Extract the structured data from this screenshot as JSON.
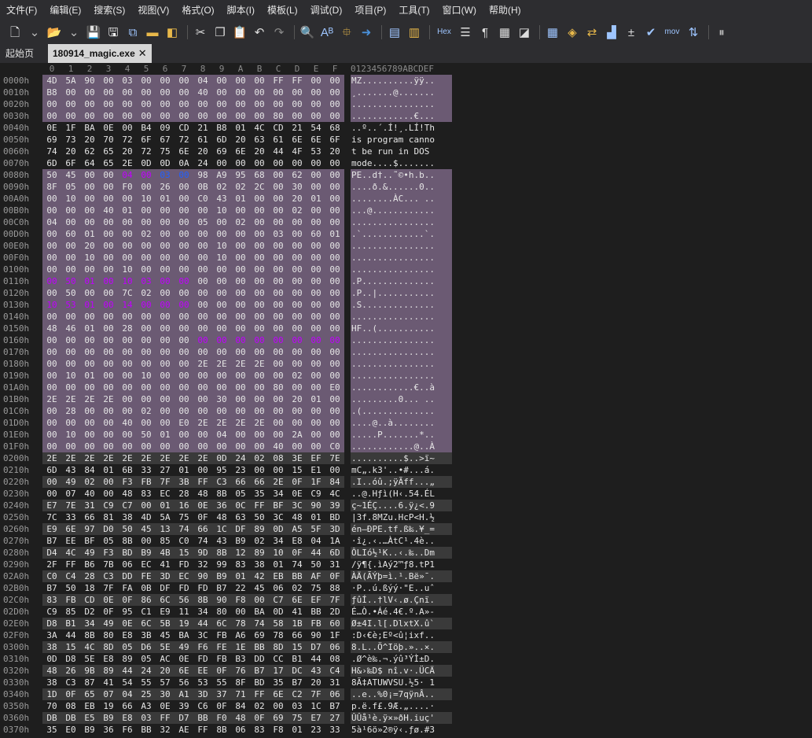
{
  "menu": [
    "文件(F)",
    "编辑(E)",
    "搜索(S)",
    "视图(V)",
    "格式(O)",
    "脚本(I)",
    "模板(L)",
    "调试(D)",
    "项目(P)",
    "工具(T)",
    "窗口(W)",
    "帮助(H)"
  ],
  "toolbar": [
    {
      "name": "new-file-icon",
      "glyph": "🗋",
      "color": "#ffffff"
    },
    {
      "name": "dropdown-arrow-icon",
      "glyph": "⌄",
      "color": "#bbbbbb"
    },
    {
      "name": "open-folder-icon",
      "glyph": "📂",
      "color": "#e8b84a"
    },
    {
      "name": "dropdown-arrow-icon",
      "glyph": "⌄",
      "color": "#bbbbbb"
    },
    {
      "name": "save-icon",
      "glyph": "💾",
      "color": "#4a90d9"
    },
    {
      "name": "save-as-icon",
      "glyph": "🖫",
      "color": "#ffffff"
    },
    {
      "name": "save-all-icon",
      "glyph": "⧉",
      "color": "#9ec5ff"
    },
    {
      "name": "folder-icon",
      "glyph": "▬",
      "color": "#e8b84a"
    },
    {
      "name": "open-project-icon",
      "glyph": "◧",
      "color": "#e8b84a"
    },
    {
      "name": "sep",
      "glyph": "",
      "color": ""
    },
    {
      "name": "cut-icon",
      "glyph": "✂",
      "color": "#dddddd"
    },
    {
      "name": "copy-icon",
      "glyph": "❐",
      "color": "#dddddd"
    },
    {
      "name": "paste-icon",
      "glyph": "📋",
      "color": "#dddddd"
    },
    {
      "name": "undo-icon",
      "glyph": "↶",
      "color": "#dddddd"
    },
    {
      "name": "redo-icon",
      "glyph": "↷",
      "color": "#888888"
    },
    {
      "name": "sep",
      "glyph": "",
      "color": ""
    },
    {
      "name": "find-icon",
      "glyph": "🔍",
      "color": "#dddddd"
    },
    {
      "name": "replace-icon",
      "glyph": "Aᴮ",
      "color": "#9ec5ff"
    },
    {
      "name": "find-in-files-icon",
      "glyph": "⯐",
      "color": "#e8b84a"
    },
    {
      "name": "goto-icon",
      "glyph": "➜",
      "color": "#4a90d9"
    },
    {
      "name": "sep",
      "glyph": "",
      "color": ""
    },
    {
      "name": "bookmark-icon",
      "glyph": "▤",
      "color": "#9ec5ff"
    },
    {
      "name": "bookmark-next-icon",
      "glyph": "▥",
      "color": "#e8b84a"
    },
    {
      "name": "sep",
      "glyph": "",
      "color": ""
    },
    {
      "name": "hex-mode-icon",
      "glyph": "Hex",
      "color": "#9ec5ff"
    },
    {
      "name": "text-mode-icon",
      "glyph": "☰",
      "color": "#dddddd"
    },
    {
      "name": "show-whitespace-icon",
      "glyph": "¶",
      "color": "#dddddd"
    },
    {
      "name": "columns-icon",
      "glyph": "▦",
      "color": "#dddddd"
    },
    {
      "name": "highlight-icon",
      "glyph": "◪",
      "color": "#dddddd"
    },
    {
      "name": "sep",
      "glyph": "",
      "color": ""
    },
    {
      "name": "calculator-icon",
      "glyph": "▦",
      "color": "#9ec5ff"
    },
    {
      "name": "templates-icon",
      "glyph": "◈",
      "color": "#e8b84a"
    },
    {
      "name": "compare-icon",
      "glyph": "⇄",
      "color": "#e8b84a"
    },
    {
      "name": "histogram-icon",
      "glyph": "▟",
      "color": "#9ec5ff"
    },
    {
      "name": "checksum-icon",
      "glyph": "±",
      "color": "#dddddd"
    },
    {
      "name": "check-icon",
      "glyph": "✔",
      "color": "#9ec5ff"
    },
    {
      "name": "disassembler-icon",
      "glyph": "mov",
      "color": "#9ec5ff"
    },
    {
      "name": "convert-icon",
      "glyph": "⇅",
      "color": "#9ec5ff"
    },
    {
      "name": "sep",
      "glyph": "",
      "color": ""
    },
    {
      "name": "pause-icon",
      "glyph": "⏸",
      "color": "#bbbbbb"
    }
  ],
  "tabs": {
    "home": "起始页",
    "active": "180914_magic.exe",
    "close_glyph": "✕"
  },
  "hex": {
    "column_labels": [
      "0",
      "1",
      "2",
      "3",
      "4",
      "5",
      "6",
      "7",
      "8",
      "9",
      "A",
      "B",
      "C",
      "D",
      "E",
      "F"
    ],
    "ascii_header": "0123456789ABCDEF",
    "rows": [
      {
        "off": "0000h",
        "hex": "4D 5A 90 00 03 00 00 00 04 00 00 00 FF FF 00 00",
        "ascii": "MZ..........ÿÿ..",
        "bg": "full"
      },
      {
        "off": "0010h",
        "hex": "B8 00 00 00 00 00 00 00 40 00 00 00 00 00 00 00",
        "ascii": "¸.......@.......",
        "bg": "full"
      },
      {
        "off": "0020h",
        "hex": "00 00 00 00 00 00 00 00 00 00 00 00 00 00 00 00",
        "ascii": "................",
        "bg": "full"
      },
      {
        "off": "0030h",
        "hex": "00 00 00 00 00 00 00 00 00 00 00 00 80 00 00 00",
        "ascii": "............€...",
        "bg": "full"
      },
      {
        "off": "0040h",
        "hex": "0E 1F BA 0E 00 B4 09 CD 21 B8 01 4C CD 21 54 68",
        "ascii": "..º..´.Í!¸.LÍ!Th",
        "bg": "none"
      },
      {
        "off": "0050h",
        "hex": "69 73 20 70 72 6F 67 72 61 6D 20 63 61 6E 6E 6F",
        "ascii": "is program canno",
        "bg": "none"
      },
      {
        "off": "0060h",
        "hex": "74 20 62 65 20 72 75 6E 20 69 6E 20 44 4F 53 20",
        "ascii": "t be run in DOS ",
        "bg": "none"
      },
      {
        "off": "0070h",
        "hex": "6D 6F 64 65 2E 0D 0D 0A 24 00 00 00 00 00 00 00",
        "ascii": "mode....$.......",
        "bg": "none"
      },
      {
        "off": "0080h",
        "hex": "50 45 00 00 04 00 03 00 98 A9 95 68 00 62 00 00",
        "ascii": "PE..d†..˜©•h.b..",
        "bg": "full",
        "hl": [
          4,
          5
        ],
        "hb": [
          6,
          7
        ]
      },
      {
        "off": "0090h",
        "hex": "8F 05 00 00 F0 00 26 00 0B 02 02 2C 00 30 00 00",
        "ascii": "....ð.&......0..",
        "bg": "full"
      },
      {
        "off": "00A0h",
        "hex": "00 10 00 00 00 10 01 00 C0 43 01 00 00 20 01 00",
        "ascii": "........ÀC... ..",
        "bg": "full"
      },
      {
        "off": "00B0h",
        "hex": "00 00 00 40 01 00 00 00 00 10 00 00 00 02 00 00",
        "ascii": "...@............",
        "bg": "full"
      },
      {
        "off": "00C0h",
        "hex": "04 00 00 00 00 00 00 00 05 00 02 00 00 00 00 00",
        "ascii": "................",
        "bg": "full"
      },
      {
        "off": "00D0h",
        "hex": "00 60 01 00 00 02 00 00 00 00 00 00 03 00 60 01",
        "ascii": ".`............`.",
        "bg": "full"
      },
      {
        "off": "00E0h",
        "hex": "00 00 20 00 00 00 00 00 00 10 00 00 00 00 00 00",
        "ascii": "................",
        "bg": "full"
      },
      {
        "off": "00F0h",
        "hex": "00 00 10 00 00 00 00 00 00 10 00 00 00 00 00 00",
        "ascii": "................",
        "bg": "full"
      },
      {
        "off": "0100h",
        "hex": "00 00 00 00 10 00 00 00 00 00 00 00 00 00 00 00",
        "ascii": "................",
        "bg": "full"
      },
      {
        "off": "0110h",
        "hex": "00 50 01 00 10 03 00 00 00 00 00 00 00 00 00 00",
        "ascii": ".P..............",
        "bg": "full",
        "hl": [
          0,
          1,
          2,
          3,
          4,
          5,
          6,
          7
        ]
      },
      {
        "off": "0120h",
        "hex": "00 50 00 00 7C 02 00 00 00 00 00 00 00 00 00 00",
        "ascii": ".P..|...........",
        "bg": "full"
      },
      {
        "off": "0130h",
        "hex": "10 53 01 00 14 00 00 00 00 00 00 00 00 00 00 00",
        "ascii": ".S..............",
        "bg": "full",
        "hl": [
          0,
          1,
          2,
          3,
          4,
          5,
          6,
          7
        ]
      },
      {
        "off": "0140h",
        "hex": "00 00 00 00 00 00 00 00 00 00 00 00 00 00 00 00",
        "ascii": "................",
        "bg": "full"
      },
      {
        "off": "0150h",
        "hex": "48 46 01 00 28 00 00 00 00 00 00 00 00 00 00 00",
        "ascii": "HF..(...........",
        "bg": "full"
      },
      {
        "off": "0160h",
        "hex": "00 00 00 00 00 00 00 00 00 00 00 00 00 00 00 00",
        "ascii": "................",
        "bg": "full",
        "hl": [
          8,
          9,
          10,
          11,
          12,
          13,
          14,
          15
        ]
      },
      {
        "off": "0170h",
        "hex": "00 00 00 00 00 00 00 00 00 00 00 00 00 00 00 00",
        "ascii": "................",
        "bg": "full"
      },
      {
        "off": "0180h",
        "hex": "00 00 00 00 00 00 00 00 2E 2E 2E 2E 00 00 00 00",
        "ascii": "................",
        "bg": "full"
      },
      {
        "off": "0190h",
        "hex": "00 10 01 00 00 10 00 00 00 00 00 00 00 02 00 00",
        "ascii": "................",
        "bg": "full"
      },
      {
        "off": "01A0h",
        "hex": "00 00 00 00 00 00 00 00 00 00 00 00 80 00 00 E0",
        "ascii": "............€..à",
        "bg": "full"
      },
      {
        "off": "01B0h",
        "hex": "2E 2E 2E 2E 00 00 00 00 00 30 00 00 00 20 01 00",
        "ascii": ".........0... ..",
        "bg": "full"
      },
      {
        "off": "01C0h",
        "hex": "00 28 00 00 00 02 00 00 00 00 00 00 00 00 00 00",
        "ascii": ".(..............",
        "bg": "full"
      },
      {
        "off": "01D0h",
        "hex": "00 00 00 00 40 00 00 E0 2E 2E 2E 2E 00 00 00 00",
        "ascii": "....@..à........",
        "bg": "full"
      },
      {
        "off": "01E0h",
        "hex": "00 10 00 00 00 50 01 00 00 04 00 00 00 2A 00 00",
        "ascii": ".....P.......*..",
        "bg": "full"
      },
      {
        "off": "01F0h",
        "hex": "00 00 00 00 00 00 00 00 00 00 00 00 40 00 00 C0",
        "ascii": "............@..À",
        "bg": "full"
      },
      {
        "off": "0200h",
        "hex": "2E 2E 2E 2E 2E 2E 2E 2E 2E 0D 24 02 08 3E EF 7E",
        "ascii": "..........$..>ï~",
        "bg": "stripe"
      },
      {
        "off": "0210h",
        "hex": "6D 43 84 01 6B 33 27 01 00 95 23 00 00 15 E1 00",
        "ascii": "mC„.k3'..•#...á.",
        "bg": "stripe"
      },
      {
        "off": "0220h",
        "hex": "00 49 02 00 F3 FB 7F 3B FF C3 66 66 2E 0F 1F 84",
        "ascii": ".I..óû.;ÿÃff...„",
        "bg": "stripe"
      },
      {
        "off": "0230h",
        "hex": "00 07 40 00 48 83 EC 28 48 8B 05 35 34 0E C9 4C",
        "ascii": "..@.Hƒì(H‹.54.ÉL",
        "bg": "stripe"
      },
      {
        "off": "0240h",
        "hex": "E7 7E 31 C9 C7 00 01 16 0E 36 0C FF BF 3C 90 39",
        "ascii": "ç~1ÉÇ....6.ÿ¿<.9",
        "bg": "stripe"
      },
      {
        "off": "0250h",
        "hex": "7C 33 66 81 38 4D 5A 75 0F 48 63 50 3C 48 01 BD",
        "ascii": "|3f.8MZu.HcP<H.½",
        "bg": "stripe"
      },
      {
        "off": "0260h",
        "hex": "E9 6E 97 D0 50 45 13 74 66 1C DF 89 0D A5 5F 3D",
        "ascii": "én—ÐPE.tf.ß‰.¥_=",
        "bg": "stripe"
      },
      {
        "off": "0270h",
        "hex": "B7 EE BF 05 8B 00 85 C0 74 43 B9 02 34 E8 04 1A",
        "ascii": "·î¿.‹.…ÀtC¹.4è..",
        "bg": "stripe"
      },
      {
        "off": "0280h",
        "hex": "D4 4C 49 F3 BD B9 4B 15 9D 8B 12 89 10 0F 44 6D",
        "ascii": "ÔLIó½¹K..‹.‰..Dm",
        "bg": "stripe"
      },
      {
        "off": "0290h",
        "hex": "2F FF B6 7B 06 EC 41 FD 32 99 83 38 01 74 50 31",
        "ascii": "/ÿ¶{.ìAý2™ƒ8.tP1",
        "bg": "stripe"
      },
      {
        "off": "02A0h",
        "hex": "C0 C4 28 C3 DD FE 3D EC 90 B9 01 42 EB BB AF 0F",
        "ascii": "ÀÄ(ÃÝþ=ì.¹.Bë»¯.",
        "bg": "stripe"
      },
      {
        "off": "02B0h",
        "hex": "B7 50 18 7F FA 0B DF FD FD B7 22 45 06 02 75 88",
        "ascii": "·P..ú.ßýý·\"E..uˆ",
        "bg": "stripe"
      },
      {
        "off": "02C0h",
        "hex": "83 FB CD 0E 0F 86 6C 56 8B 90 F8 00 C7 6E EF 7F",
        "ascii": "ƒûÍ..†lV‹.ø.Çnï.",
        "bg": "stripe"
      },
      {
        "off": "02D0h",
        "hex": "C9 85 D2 0F 95 C1 E9 11 34 80 00 BA 0D 41 BB 2D",
        "ascii": "É…Ò.•Áé.4€.º.A»-",
        "bg": "stripe"
      },
      {
        "off": "02E0h",
        "hex": "D8 B1 34 49 0E 6C 5B 19 44 6C 78 74 58 1B FB 60",
        "ascii": "Ø±4I.l[.DlxtX.û`",
        "bg": "stripe"
      },
      {
        "off": "02F0h",
        "hex": "3A 44 8B 80 E8 3B 45 BA 3C FB A6 69 78 66 90 1F",
        "ascii": ":D‹€è;Eº<û¦ixf..",
        "bg": "stripe"
      },
      {
        "off": "0300h",
        "hex": "38 15 4C 8D 05 D6 5E 49 F6 FE 1E BB 8D 15 D7 06",
        "ascii": "8.L..Ö^Iöþ.»..×.",
        "bg": "stripe"
      },
      {
        "off": "0310h",
        "hex": "0D D8 5E E8 89 05 AC 0E FD FB B3 DD CC B1 44 08",
        "ascii": ".Ø^è‰.¬.ýû³ÝÌ±D.",
        "bg": "stripe"
      },
      {
        "off": "0320h",
        "hex": "48 26 9B 89 44 24 20 6E EE 0F 76 B7 17 DC 43 C4",
        "ascii": "H&›‰D$ nî.v·.ÜCÄ",
        "bg": "stripe"
      },
      {
        "off": "0330h",
        "hex": "38 C3 87 41 54 55 57 56 53 55 8F BD 35 B7 20 31",
        "ascii": "8Ã‡ATUWVSU.½5· 1",
        "bg": "stripe"
      },
      {
        "off": "0340h",
        "hex": "1D 0F 65 07 04 25 30 A1 3D 37 71 FF 6E C2 7F 06",
        "ascii": "..e..%0¡=7qÿnÂ..",
        "bg": "stripe"
      },
      {
        "off": "0350h",
        "hex": "70 08 EB 19 66 A3 0E 39 C6 0F 84 02 00 03 1C B7",
        "ascii": "p.ë.f£.9Æ.„....·",
        "bg": "stripe"
      },
      {
        "off": "0360h",
        "hex": "DB DB E5 B9 E8 03 FF D7 BB F0 48 0F 69 75 E7 27",
        "ascii": "ÛÛå¹è.ÿ×»ðH.iuç'",
        "bg": "stripe"
      },
      {
        "off": "0370h",
        "hex": "35 E0 B9 36 F6 BB 32 AE FF 8B 06 83 F8 01 23 33",
        "ascii": "5à¹6ö»2®ÿ‹.ƒø.#3",
        "bg": "stripe"
      }
    ]
  },
  "colors": {
    "selection_bg": "#6b5a73",
    "stripe_bg": "#3a3a3a",
    "highlight_red": "#c000ff",
    "highlight_blue": "#2060ff"
  }
}
